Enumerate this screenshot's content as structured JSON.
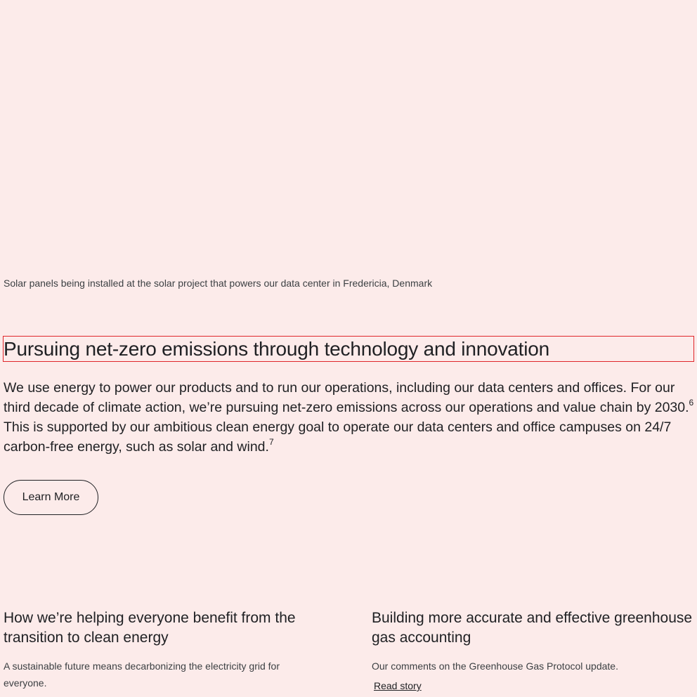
{
  "hero": {
    "caption": "Solar panels being installed at the solar project that powers our data center in Fredericia, Denmark"
  },
  "section": {
    "heading": "Pursuing net-zero emissions through technology and innovation",
    "body_part1": "We use energy to power our products and to run our operations, including our data centers and offices. For our third decade of climate action, we’re pursuing net-zero emissions across our operations and value chain by 2030.",
    "footnote1": "6",
    "body_part2": " This is supported by our ambitious clean energy goal to operate our data centers and office campuses on 24/7 carbon-free energy, such as solar and wind.",
    "footnote2": "7",
    "learn_more_label": "Learn More"
  },
  "cards": [
    {
      "title": "How we’re helping everyone benefit from the transition to clean energy",
      "description": "A sustainable future means decarbonizing the electricity grid for everyone."
    },
    {
      "title": "Building more accurate and effective greenhouse gas accounting",
      "description": "Our comments on the Greenhouse Gas Protocol update.",
      "link_label": "Read story"
    }
  ],
  "colors": {
    "background": "#fcebea",
    "text": "#202124",
    "focus_outline": "#e0262a"
  }
}
